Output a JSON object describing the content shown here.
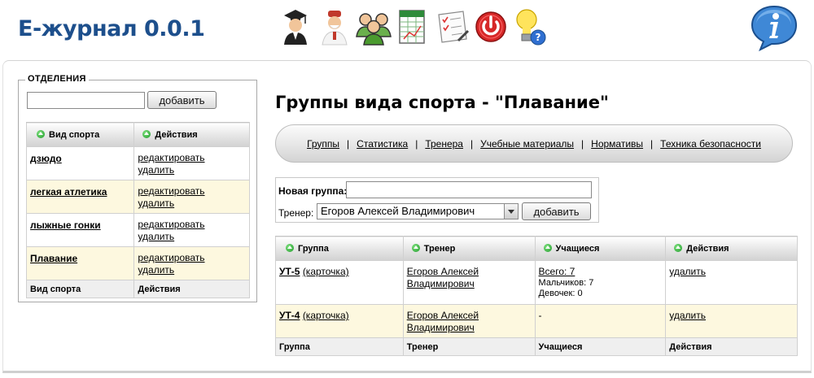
{
  "app": {
    "title": "Е-журнал 0.0.1",
    "info_icon": "info-icon"
  },
  "toolbar": {
    "icons": [
      "student-icon",
      "teacher-icon",
      "group-icon",
      "spreadsheet-icon",
      "checklist-icon",
      "power-icon",
      "help-bulb-icon"
    ]
  },
  "departments": {
    "legend": "ОТДЕЛЕНИЯ",
    "input_value": "",
    "add_label": "добавить",
    "headers": [
      "Вид спорта",
      "Действия"
    ],
    "rows": [
      {
        "sport": "дзюдо",
        "edit": "редактировать",
        "delete": "удалить"
      },
      {
        "sport": "легкая атлетика",
        "edit": "редактировать",
        "delete": "удалить"
      },
      {
        "sport": "лыжные гонки",
        "edit": "редактировать",
        "delete": "удалить"
      },
      {
        "sport": "Плавание",
        "edit": "редактировать",
        "delete": "удалить"
      }
    ],
    "footers": [
      "Вид спорта",
      "Действия"
    ]
  },
  "main": {
    "title": "Группы вида спорта - \"Плавание\"",
    "nav": [
      "Группы",
      "Статистика",
      "Тренера",
      "Учебные материалы",
      "Нормативы",
      "Техника безопасности"
    ],
    "nav_sep": "|",
    "new_group_label": "Новая группа:",
    "new_group_value": "",
    "trainer_label": "Тренер:",
    "trainer_selected": "Егоров Алексей Владимирович",
    "add_label": "добавить"
  },
  "groups": {
    "headers": [
      "Группа",
      "Тренер",
      "Учащиеся",
      "Действия"
    ],
    "rows": [
      {
        "group": "УТ-5",
        "card": "(карточка)",
        "trainer_line1": "Егоров Алексей",
        "trainer_line2": "Владимирович",
        "total": "Всего: 7",
        "boys": "Мальчиков: 7",
        "girls": "Девочек: 0",
        "action": "удалить"
      },
      {
        "group": "УТ-4",
        "card": "(карточка)",
        "trainer_line1": "Егоров Алексей",
        "trainer_line2": "Владимирович",
        "students": "-",
        "action": "удалить"
      }
    ],
    "footers": [
      "Группа",
      "Тренер",
      "Учащиеся",
      "Действия"
    ]
  }
}
